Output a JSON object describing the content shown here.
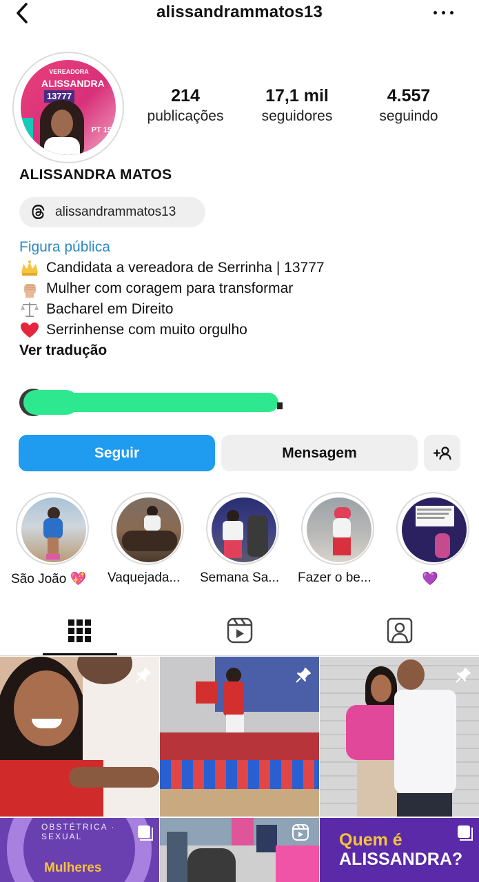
{
  "header": {
    "username": "alissandrammatos13"
  },
  "profile": {
    "avatar_text_line1": "VEREADORA",
    "avatar_text_line2": "ALISSANDRA",
    "avatar_number": "13777",
    "avatar_party": "PT 15",
    "display_name": "ALISSANDRA MATOS",
    "threads_handle": "alissandrammatos13",
    "category": "Figura pública",
    "bio": [
      {
        "icon": "crown-emoji",
        "text": "Candidata a vereadora de Serrinha | 13777"
      },
      {
        "icon": "raised-fist-emoji",
        "text": "Mulher com coragem para transformar"
      },
      {
        "icon": "scales-emoji",
        "text": "Bacharel em Direito"
      },
      {
        "icon": "red-heart-emoji",
        "text": "Serrinhense com muito orgulho"
      }
    ],
    "translate_label": "Ver tradução"
  },
  "stats": [
    {
      "value": "214",
      "label": "publicações"
    },
    {
      "value": "17,1 mil",
      "label": "seguidores"
    },
    {
      "value": "4.557",
      "label": "seguindo"
    }
  ],
  "actions": {
    "follow_label": "Seguir",
    "message_label": "Mensagem"
  },
  "highlights": [
    {
      "label": "São João 💖"
    },
    {
      "label": "Vaquejada..."
    },
    {
      "label": "Semana Sa..."
    },
    {
      "label": "Fazer o be..."
    },
    {
      "label": "💜"
    }
  ],
  "tabs": [
    "grid-icon",
    "reels-icon",
    "tagged-icon"
  ],
  "grid": {
    "row2_tile3_text_line1": "Quem é",
    "row2_tile3_text_line2": "ALISSANDRA?",
    "row2_tile1_text": "Mulheres",
    "row2_tile1_ring_text": "OBSTÉTRICA · SEXUAL"
  },
  "colors": {
    "accent_blue": "#1f9bf0",
    "category_blue": "#2b87c2",
    "button_gray": "#efefef"
  }
}
